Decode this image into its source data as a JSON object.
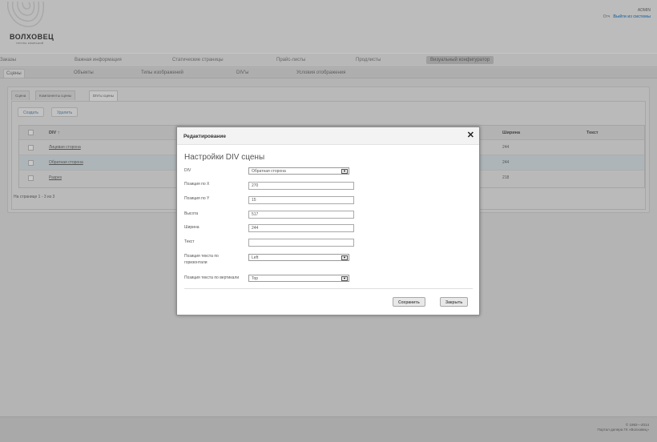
{
  "header": {
    "logo_text": "ВОЛХОВЕЦ",
    "logo_sub": "ГРУППА КОМПАНИЙ",
    "user_name": "ADMIN",
    "exit_short": "Отч",
    "logout_label": "Выйти из системы"
  },
  "main_nav": {
    "items": [
      {
        "label": "Заказы"
      },
      {
        "label": "Важная информация"
      },
      {
        "label": "Статические страницы"
      },
      {
        "label": "Прайс-листы"
      },
      {
        "label": "Продлисты"
      },
      {
        "label": "Визуальный конфигуратор"
      }
    ]
  },
  "sub_nav": {
    "items": [
      {
        "label": "Сцены"
      },
      {
        "label": "Объекты"
      },
      {
        "label": "Типы изображений"
      },
      {
        "label": "DIV'ы"
      },
      {
        "label": "Условия отображения"
      }
    ]
  },
  "tabs": [
    {
      "label": "Сцена"
    },
    {
      "label": "Компоненты сцены"
    },
    {
      "label": "DIV'ы сцены"
    }
  ],
  "actions": {
    "create": "Создать",
    "delete": "Удалить"
  },
  "grid": {
    "columns": {
      "div": "DIV ↑",
      "width": "Ширина",
      "text": "Текст"
    },
    "rows": [
      {
        "name": "Лицевая сторона",
        "width": "244"
      },
      {
        "name": "Обратная сторона",
        "width": "244"
      },
      {
        "name": "Разрез",
        "width": "218"
      }
    ],
    "pager": "На странице 1 - 3 из 3"
  },
  "footer": {
    "copyright": "© 1992—2014",
    "portal": "Портал дилера ГК «Волховец»"
  },
  "modal": {
    "title": "Редактирование",
    "close": "✕",
    "heading": "Настройки DIV сцены",
    "fields": {
      "div": {
        "label": "DIV",
        "value": "Обратная сторона"
      },
      "pos_x": {
        "label": "Позиция по X",
        "value": "270"
      },
      "pos_y": {
        "label": "Позиция по Y",
        "value": "15"
      },
      "height": {
        "label": "Высота",
        "value": "517"
      },
      "width": {
        "label": "Ширина",
        "value": "244"
      },
      "text": {
        "label": "Текст",
        "value": ""
      },
      "h_align": {
        "label": "Позиция текста по горизонтали",
        "value": "Left"
      },
      "v_align": {
        "label": "Позиция текста по вертикали",
        "value": "Top"
      }
    },
    "save": "Сохранить",
    "close_button": "Закрыть"
  }
}
